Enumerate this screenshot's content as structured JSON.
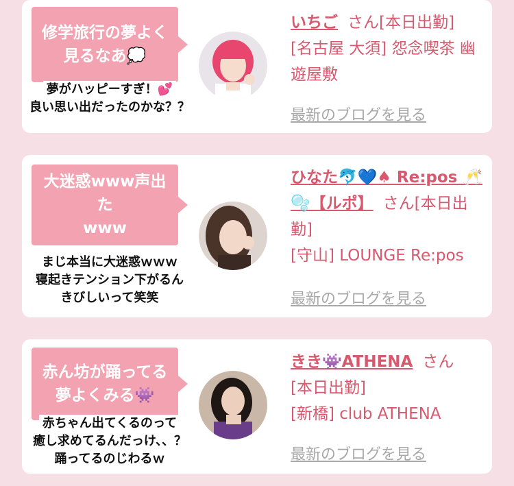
{
  "blog_link_label": "最新のブログを見る",
  "colors": {
    "accent": "#d8586e",
    "bubble": "#f2a2b0",
    "background": "#f6dfe5"
  },
  "cards": [
    {
      "bubble": "修学旅行の夢よく\n見るなあ💭",
      "caption_lines": [
        "夢がハッピーすぎ！💕",
        "良い思い出だったのかな？？"
      ],
      "name": "いちご",
      "san": "さん",
      "status": "[本日出勤]",
      "shop": "[名古屋 大須] 怨念喫茶 幽遊屋敷"
    },
    {
      "bubble": "大迷惑www声出た\nwww",
      "caption_lines": [
        "まじ本当に大迷惑ｗｗｗ",
        "寝起きテンション下がるん",
        "きびしいって笑笑"
      ],
      "name": "ひなた🐬💙♠ Re:pos 🥂🫧【ルポ】",
      "san": "さん",
      "status": "[本日出勤]",
      "shop": "[守山] LOUNGE Re:pos"
    },
    {
      "bubble": "赤ん坊が踊ってる\n夢よくみる👾",
      "caption_lines": [
        "赤ちゃん出てくるのって",
        "癒し求めてるんだっけ、、？",
        "踊ってるのじわるｗ"
      ],
      "name": "きき👾ATHENA",
      "san": "さん",
      "status": "[本日出勤]",
      "shop": "[新橋] club ATHENA"
    }
  ]
}
